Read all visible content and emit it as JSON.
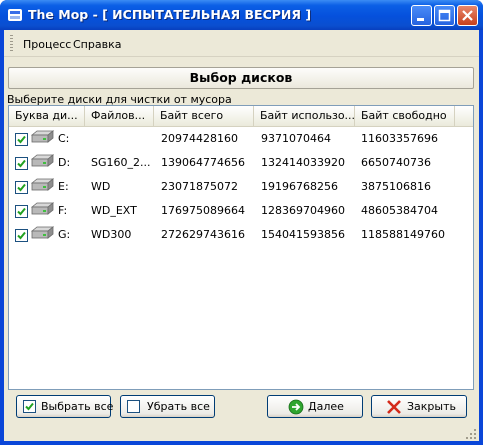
{
  "window": {
    "title": "The Mop - [ ИСПЫТАТЕЛЬНАЯ ВЕСРИЯ ]",
    "buttons": [
      "minimize",
      "maximize",
      "close"
    ]
  },
  "menu": {
    "items": [
      {
        "label": "Процесс"
      },
      {
        "label": "Справка"
      }
    ]
  },
  "panel": {
    "title": "Выбор дисков",
    "instruction": "Выберите диски для чистки от мусора"
  },
  "table": {
    "columns": [
      "Буква ди...",
      "Файлов...",
      "Байт всего",
      "Байт использо...",
      "Байт свободно"
    ],
    "rows": [
      {
        "checked": true,
        "letter": "C:",
        "fs": "",
        "total": "20974428160",
        "used": "9371070464",
        "free": "11603357696"
      },
      {
        "checked": true,
        "letter": "D:",
        "fs": "SG160_2...",
        "total": "139064774656",
        "used": "132414033920",
        "free": "6650740736"
      },
      {
        "checked": true,
        "letter": "E:",
        "fs": "WD",
        "total": "23071875072",
        "used": "19196768256",
        "free": "3875106816"
      },
      {
        "checked": true,
        "letter": "F:",
        "fs": "WD_EXT",
        "total": "176975089664",
        "used": "128369704960",
        "free": "48605384704"
      },
      {
        "checked": true,
        "letter": "G:",
        "fs": "WD300",
        "total": "272629743616",
        "used": "154041593856",
        "free": "118588149760"
      }
    ]
  },
  "footer": {
    "select_all": {
      "label": "Выбрать все",
      "checked": true
    },
    "deselect_all": {
      "label": "Убрать все",
      "checked": false
    },
    "next_label": "Далее",
    "close_label": "Закрыть"
  },
  "colors": {
    "titlebar": "#0550dc",
    "face": "#ece9d8",
    "list_border": "#7f9db9",
    "check_mark": "#21a121"
  }
}
